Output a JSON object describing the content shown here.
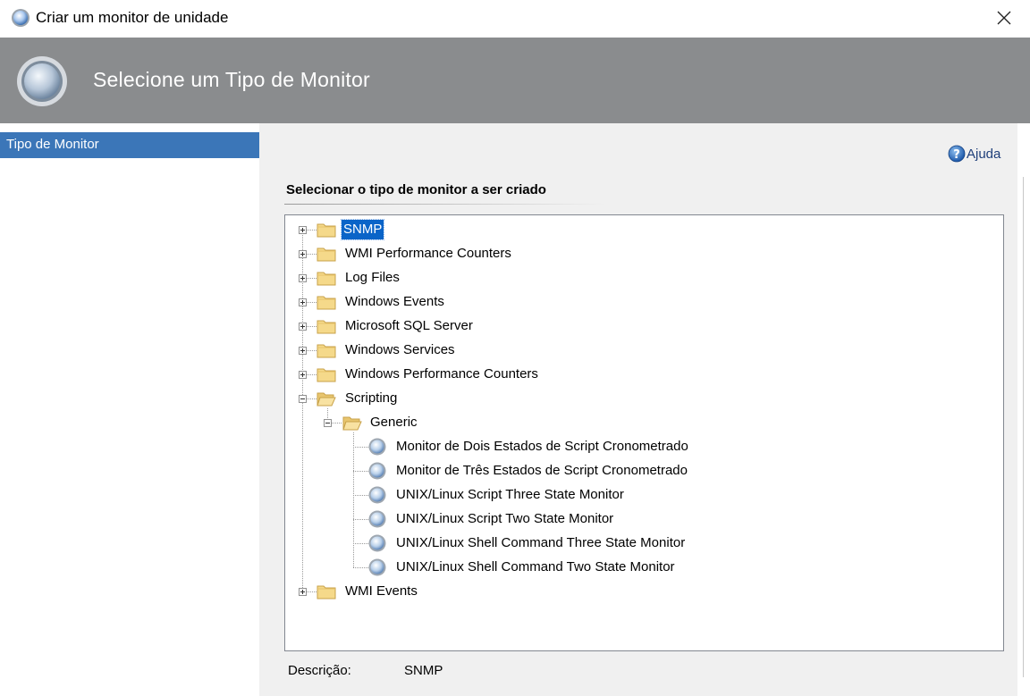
{
  "window": {
    "title": "Criar um monitor de unidade"
  },
  "banner": {
    "heading": "Selecione um Tipo de Monitor"
  },
  "nav": {
    "items": [
      {
        "label": "Tipo de Monitor",
        "selected": true
      }
    ]
  },
  "help": {
    "label": "Ajuda"
  },
  "main": {
    "section_title": "Selecionar o tipo de monitor a ser criado"
  },
  "tree": {
    "nodes": [
      {
        "label": "SNMP",
        "type": "folder",
        "expander": "plus",
        "selected": true
      },
      {
        "label": "WMI Performance Counters",
        "type": "folder",
        "expander": "plus"
      },
      {
        "label": "Log Files",
        "type": "folder",
        "expander": "plus"
      },
      {
        "label": "Windows Events",
        "type": "folder",
        "expander": "plus"
      },
      {
        "label": "Microsoft SQL Server",
        "type": "folder",
        "expander": "plus"
      },
      {
        "label": "Windows Services",
        "type": "folder",
        "expander": "plus"
      },
      {
        "label": "Windows Performance Counters",
        "type": "folder",
        "expander": "plus"
      },
      {
        "label": "Scripting",
        "type": "folder-open",
        "expander": "minus"
      },
      {
        "label": "Generic",
        "type": "folder-open",
        "expander": "minus"
      },
      {
        "label": "Monitor de Dois Estados de Script Cronometrado",
        "type": "monitor"
      },
      {
        "label": "Monitor de Três Estados de Script Cronometrado",
        "type": "monitor"
      },
      {
        "label": "UNIX/Linux Script Three State Monitor",
        "type": "monitor"
      },
      {
        "label": "UNIX/Linux Script Two State Monitor",
        "type": "monitor"
      },
      {
        "label": "UNIX/Linux Shell Command Three State Monitor",
        "type": "monitor"
      },
      {
        "label": "UNIX/Linux Shell Command Two State Monitor",
        "type": "monitor"
      },
      {
        "label": "WMI Events",
        "type": "folder",
        "expander": "plus"
      }
    ]
  },
  "description": {
    "label": "Descrição:",
    "value": "SNMP"
  },
  "colors": {
    "banner": "#8a8c8e",
    "nav_selected": "#3b76b8",
    "tree_selected": "#0a64c8",
    "panel": "#f0f0f0"
  }
}
